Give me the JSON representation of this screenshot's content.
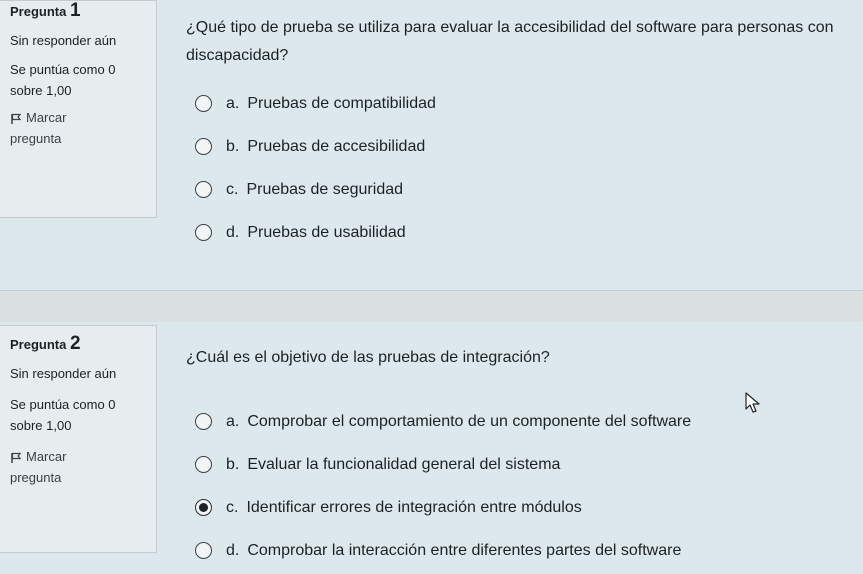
{
  "questions": [
    {
      "number_label": "Pregunta",
      "number": "1",
      "state": "Sin responder aún",
      "grade": "Se puntúa como 0 sobre 1,00",
      "flag_label": "Marcar pregunta",
      "text": "¿Qué tipo de prueba se utiliza para evaluar la accesibilidad del software para personas con discapacidad?",
      "answers": [
        {
          "letter": "a.",
          "text": "Pruebas de compatibilidad",
          "selected": false
        },
        {
          "letter": "b.",
          "text": "Pruebas de accesibilidad",
          "selected": false
        },
        {
          "letter": "c.",
          "text": "Pruebas de seguridad",
          "selected": false
        },
        {
          "letter": "d.",
          "text": "Pruebas de usabilidad",
          "selected": false
        }
      ]
    },
    {
      "number_label": "Pregunta",
      "number": "2",
      "state": "Sin responder aún",
      "grade": "Se puntúa como 0 sobre 1,00",
      "flag_label": "Marcar pregunta",
      "text": "¿Cuál es el objetivo de las pruebas de integración?",
      "answers": [
        {
          "letter": "a.",
          "text": "Comprobar el comportamiento de un componente del software",
          "selected": false
        },
        {
          "letter": "b.",
          "text": "Evaluar la funcionalidad general del sistema",
          "selected": false
        },
        {
          "letter": "c.",
          "text": "Identificar errores de integración entre módulos",
          "selected": true
        },
        {
          "letter": "d.",
          "text": "Comprobar la interacción entre diferentes partes del software",
          "selected": false
        }
      ]
    }
  ],
  "icons": {
    "flag": "flag-icon",
    "cursor": "mouse-cursor-icon"
  }
}
